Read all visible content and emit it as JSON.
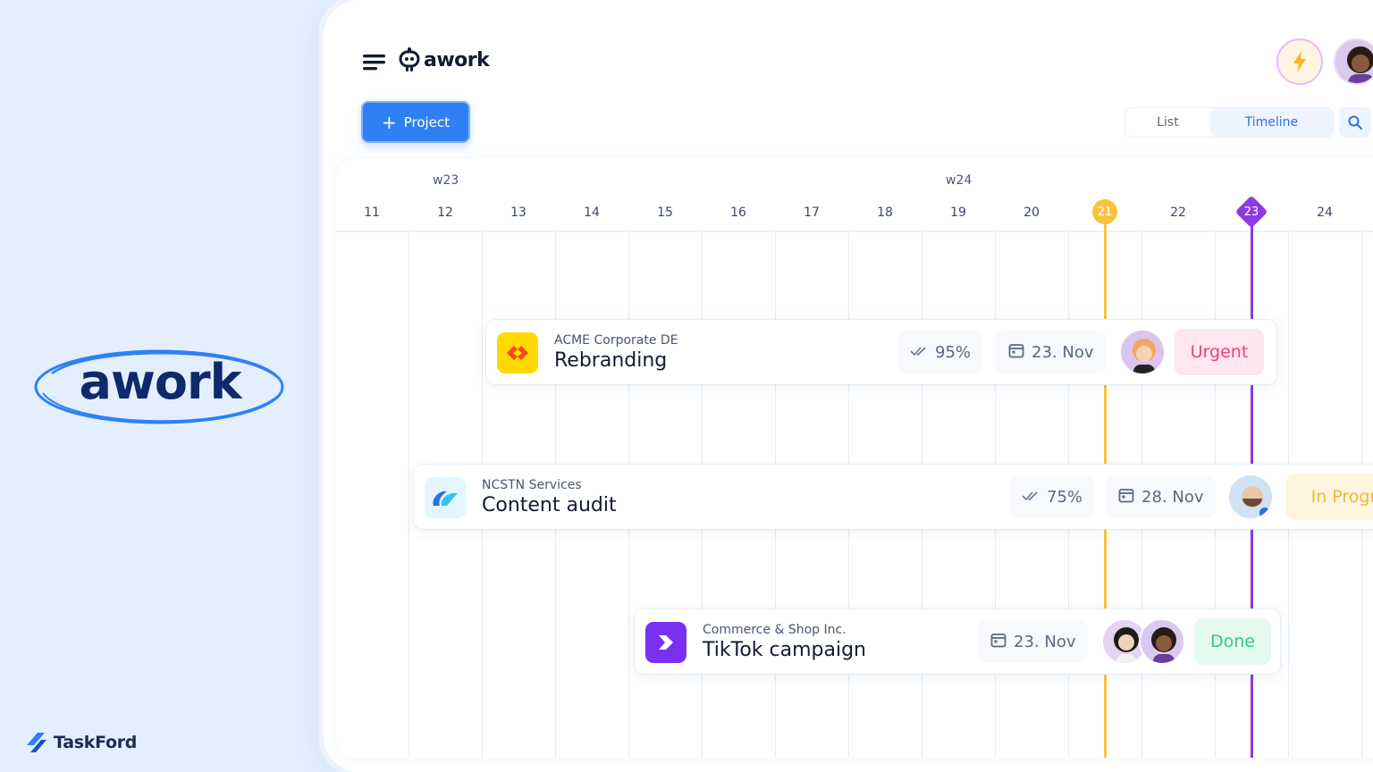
{
  "promo": {
    "logo_text": "awork",
    "brand_name": "TaskFord"
  },
  "app": {
    "logo_text": "awork",
    "project_button": "Project",
    "views": {
      "list": "List",
      "timeline": "Timeline"
    }
  },
  "timeline": {
    "weeks": [
      "w23",
      "w24"
    ],
    "days": [
      "11",
      "12",
      "13",
      "14",
      "15",
      "16",
      "17",
      "18",
      "19",
      "20",
      "21",
      "22",
      "23",
      "24"
    ],
    "today": "21",
    "deadline": "23",
    "colors": {
      "today": "#f8c33f",
      "deadline": "#8f38e5",
      "accent": "#2f80f5"
    }
  },
  "tasks": [
    {
      "client": "ACME Corporate DE",
      "title": "Rebranding",
      "progress": "95%",
      "due": "23. Nov",
      "status": "Urgent",
      "status_color": "#ef3f7b"
    },
    {
      "client": "NCSTN Services",
      "title": "Content audit",
      "progress": "75%",
      "due": "28. Nov",
      "status": "In Progress",
      "status_color": "#f1b73b"
    },
    {
      "client": "Commerce & Shop Inc.",
      "title": "TikTok campaign",
      "due": "23. Nov",
      "status": "Done",
      "status_color": "#2fc98a"
    }
  ]
}
